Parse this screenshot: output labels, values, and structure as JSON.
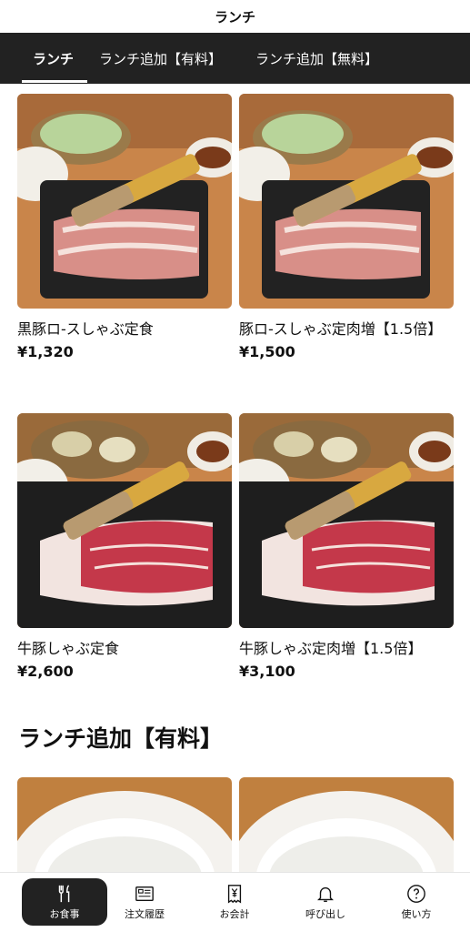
{
  "header": {
    "title": "ランチ"
  },
  "tabs": [
    {
      "label": "ランチ",
      "active": true
    },
    {
      "label": "ランチ追加【有料】",
      "active": false
    },
    {
      "label": "ランチ追加【無料】",
      "active": false
    }
  ],
  "menu_items": [
    {
      "name": "黒豚ロ-スしゃぶ定食",
      "price": "¥1,320"
    },
    {
      "name": "豚ロ-スしゃぶ定肉増【1.5倍】",
      "price": "¥1,500"
    },
    {
      "name": "牛豚しゃぶ定食",
      "price": "¥2,600"
    },
    {
      "name": "牛豚しゃぶ定肉増【1.5倍】",
      "price": "¥3,100"
    }
  ],
  "section": {
    "title": "ランチ追加【有料】"
  },
  "bottom_nav": [
    {
      "label": "お食事",
      "icon": "fork-knife-icon",
      "active": true
    },
    {
      "label": "注文履歴",
      "icon": "receipt-list-icon",
      "active": false
    },
    {
      "label": "お会計",
      "icon": "yen-bill-icon",
      "active": false
    },
    {
      "label": "呼び出し",
      "icon": "bell-icon",
      "active": false
    },
    {
      "label": "使い方",
      "icon": "help-circle-icon",
      "active": false
    }
  ],
  "colors": {
    "tabbar_bg": "#222222",
    "active_nav_bg": "#222222",
    "text": "#111111"
  }
}
